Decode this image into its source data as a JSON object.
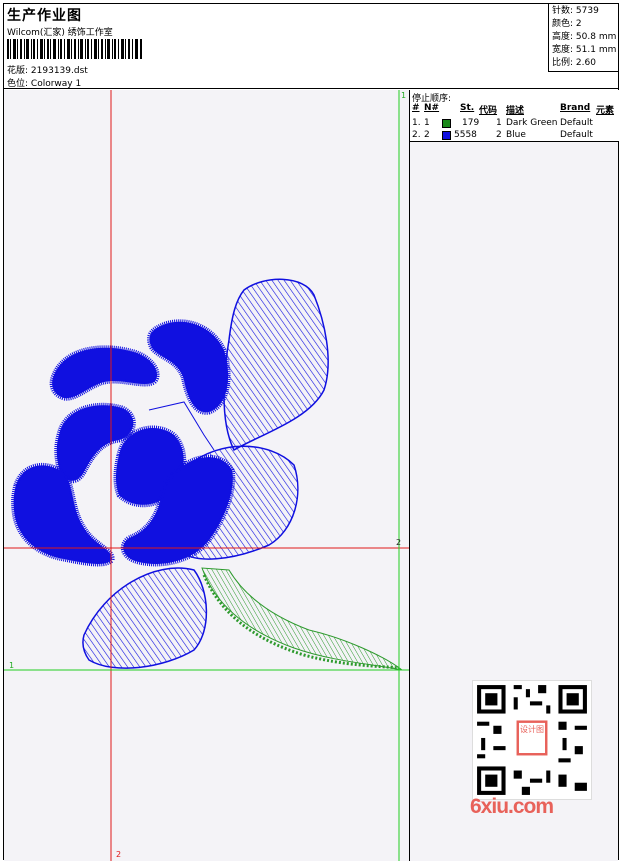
{
  "header": {
    "title": "生产作业图",
    "studio": "Wilcom(汇家) 绣饰工作室",
    "design_label": "花版:",
    "design_value": "2193139.dst",
    "color_label": "色位:",
    "color_value": "Colorway 1"
  },
  "stats": [
    {
      "label": "针数:",
      "value": "5739"
    },
    {
      "label": "颜色:",
      "value": "2"
    },
    {
      "label": "高度:",
      "value": "50.8 mm"
    },
    {
      "label": "宽度:",
      "value": "51.1 mm"
    },
    {
      "label": "比例:",
      "value": "2.60"
    }
  ],
  "stop_sequence": {
    "title": "停止顺序:",
    "headers": [
      "#",
      "N#",
      "St.",
      "代码",
      "描述",
      "Brand",
      "元素"
    ],
    "rows": [
      {
        "index": "1.",
        "n": "1",
        "stitches": "179",
        "code": "1",
        "description": "Dark Green",
        "brand": "Default",
        "color": "#1a8a1a"
      },
      {
        "index": "2.",
        "n": "2",
        "stitches": "5558",
        "code": "2",
        "description": "Blue",
        "brand": "Default",
        "color": "#1010e0"
      }
    ]
  },
  "guides": {
    "top_left_marker": "1",
    "horizontal_red_marker": "2",
    "horizontal_green_marker": "1",
    "bottom_red_marker": "2"
  },
  "watermark": {
    "site": "6xiu.com",
    "qr_stamp": "设计图"
  },
  "colors": {
    "thread_blue": "#1010e0",
    "thread_green": "#2d9a2d",
    "guide_red": "#e01818",
    "guide_green": "#22cc22"
  }
}
